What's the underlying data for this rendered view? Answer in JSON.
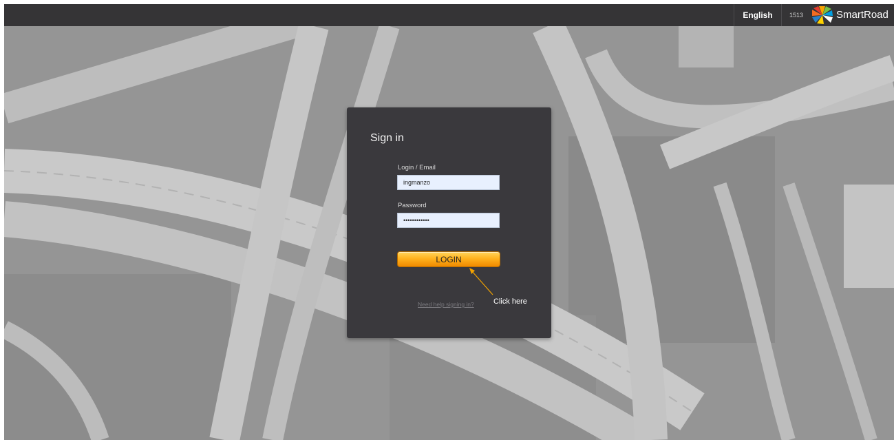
{
  "header": {
    "language": "English",
    "version": "1513",
    "brand": "SmartRoad"
  },
  "login": {
    "title": "Sign in",
    "login_label": "Login / Email",
    "login_value": "ingmanzo",
    "password_label": "Password",
    "password_value": "••••••••••••",
    "button_label": "LOGIN",
    "help_link": "Need help signing in?",
    "annotation": "Click here"
  },
  "colors": {
    "topbar": "#353436",
    "card": "#3a393d",
    "button": "#ffb21e",
    "input": "#e8f0fe",
    "arrow": "#f2a200"
  },
  "icons": {
    "logo": "smartroad-logo-icon",
    "annotation_arrow": "arrow-icon"
  }
}
